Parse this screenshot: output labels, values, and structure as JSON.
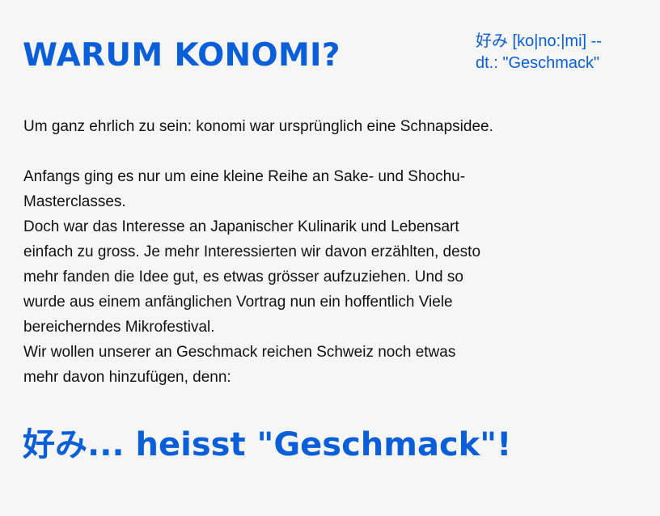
{
  "heading": "WARUM KONOMI?",
  "side_note": {
    "line1": "好み [ko|no:|mi] --",
    "line2": "dt.: \"Geschmack\""
  },
  "paragraphs": {
    "intro": "Um ganz ehrlich zu sein: konomi war ursprünglich eine Schnapsidee.",
    "l1": "Anfangs ging es nur um eine kleine Reihe an Sake- und Shochu-",
    "l2": "Masterclasses.",
    "l3": "Doch war das Interesse an Japanischer Kulinarik und Lebensart",
    "l4": "einfach zu gross. Je mehr Interessierten wir davon erzählten, desto",
    "l5": "mehr fanden die Idee gut, es etwas grösser aufzuziehen. Und so",
    "l6": "wurde aus einem anfänglichen Vortrag nun ein hoffentlich Viele",
    "l7": "bereicherndes Mikrofestival.",
    "l8": "Wir wollen unserer an Geschmack reichen Schweiz noch etwas",
    "l9": "mehr davon hinzufügen, denn:"
  },
  "tagline": "好み... heisst \"Geschmack\"!",
  "colors": {
    "accent": "#0a5fd8",
    "text": "#111111",
    "background": "#f6f6f6"
  }
}
